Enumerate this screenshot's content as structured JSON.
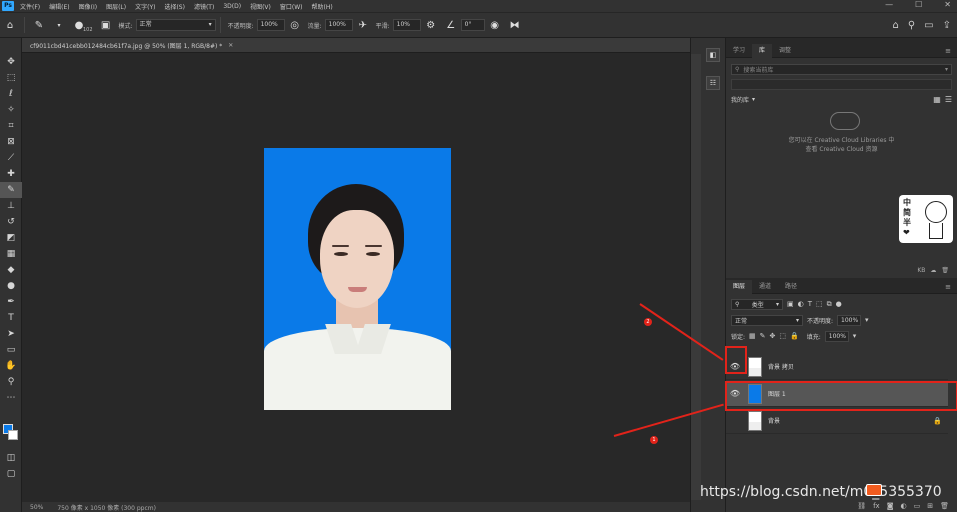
{
  "app": {
    "logo": "Ps"
  },
  "menu": [
    "文件(F)",
    "编辑(E)",
    "图像(I)",
    "图层(L)",
    "文字(Y)",
    "选择(S)",
    "滤镜(T)",
    "3D(D)",
    "视图(V)",
    "窗口(W)",
    "帮助(H)"
  ],
  "window_controls": [
    "—",
    "☐",
    "✕"
  ],
  "options": {
    "brush_size": "102",
    "mode_label": "模式:",
    "mode_value": "正常",
    "opacity_label": "不透明度:",
    "opacity_value": "100%",
    "flow_label": "流量:",
    "flow_value": "100%",
    "smooth_label": "平滑:",
    "smooth_value": "10%",
    "angle_value": "0°"
  },
  "document": {
    "tab_title": "cf9011cbd41cebb012484cb61f7a.jpg @ 50% (图层 1, RGB/8#) *",
    "close": "✕"
  },
  "status": {
    "zoom": "50%",
    "size": "750 像素 x 1050 像素 (300 ppcm)"
  },
  "libraries": {
    "tabs": [
      "学习",
      "库",
      "调整"
    ],
    "search_placeholder": "搜索当前库",
    "current_library": "我的库",
    "empty_message_line1": "您可以在 Creative Cloud Libraries 中",
    "empty_message_line2": "查看 Creative Cloud 资源",
    "footer_size": "KB"
  },
  "sticker": {
    "text": [
      "中",
      "简",
      "半",
      "❤"
    ]
  },
  "layers": {
    "tabs": [
      "图层",
      "通道",
      "路径"
    ],
    "filter_label": "类型",
    "blend_mode": "正常",
    "opacity_label": "不透明度:",
    "opacity_value": "100%",
    "lock_label": "锁定:",
    "fill_label": "填充:",
    "fill_value": "100%",
    "items": [
      {
        "name": "背景 拷贝",
        "visible": true,
        "selected": false,
        "thumb": "photo"
      },
      {
        "name": "图层 1",
        "visible": true,
        "selected": true,
        "thumb": "#0a7ae8"
      },
      {
        "name": "背景",
        "visible": false,
        "selected": false,
        "thumb": "photo",
        "locked": true
      }
    ]
  },
  "annotations": [
    "2",
    "1"
  ],
  "watermark": "https://blog.csdn.net/m0_5355370"
}
